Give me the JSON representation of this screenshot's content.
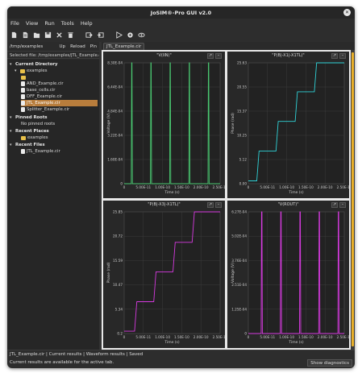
{
  "window": {
    "title": "JoSIM®-Pro GUI v2.0"
  },
  "menu": [
    "File",
    "View",
    "Run",
    "Tools",
    "Help"
  ],
  "toolbar": [
    {
      "icon": "new-file-icon"
    },
    {
      "icon": "open-file-icon"
    },
    {
      "icon": "open-folder-icon"
    },
    {
      "icon": "save-icon"
    },
    {
      "icon": "cut-icon"
    },
    {
      "icon": "delete-icon"
    },
    {
      "icon": "import-icon"
    },
    {
      "icon": "export-icon"
    },
    {
      "icon": "run-icon"
    },
    {
      "icon": "settings-icon"
    },
    {
      "icon": "view-icon"
    }
  ],
  "left": {
    "path": "/tmp/examples",
    "btn_up": "Up",
    "btn_reload": "Reload",
    "btn_pin": "Pin",
    "selected_file": "Selected file: /tmp/examples/JTL_Example.cir",
    "current_directory_label": "Current Directory",
    "root_folder": "examples",
    "blank_folder": "",
    "files": [
      "AND_Example.cir",
      "base_cells.cir",
      "DFF_Example.cir",
      "JTL_Example.cir",
      "Splitter_Example.cir"
    ],
    "pinned_roots_label": "Pinned Roots",
    "pinned_empty": "No pinned roots",
    "recent_places_label": "Recent Places",
    "recent_place": "examples",
    "recent_files_label": "Recent Files",
    "recent_file": "JTL_Example.cir"
  },
  "main": {
    "tab": "JTL_Example.cir",
    "maximize_label": "↗",
    "minimize_label": "–"
  },
  "status": {
    "line1": "JTL_Example.cir | Current results | Waveform results | Saved",
    "line2": "Current results are available for the active tab.",
    "diagnostics_button": "Show diagnostics"
  },
  "chart_data": [
    {
      "type": "line",
      "title": "\"V(IIN)\"",
      "xlabel": "Time (s)",
      "ylabel": "Voltage (V)",
      "color": "#49c770",
      "xlim": [
        0,
        2.5e-10
      ],
      "ylim": [
        0,
        0.000806
      ],
      "x_ticks": [
        "0",
        "5.00E-11",
        "1.00E-10",
        "1.50E-10",
        "2.00E-10",
        "2.50E-10"
      ],
      "y_ticks": [
        "0",
        "1.60E-04",
        "3.22E-04",
        "4.84E-04",
        "6.44E-04",
        "8.30E-04"
      ],
      "pulses_at": [
        2e-11,
        7e-11,
        1.2e-10,
        1.7e-10,
        2.2e-10
      ],
      "peak": 0.000806
    },
    {
      "type": "line",
      "title": "\"P(B|-X1|-X1TL)\"",
      "xlabel": "Time (s)",
      "ylabel": "Phase (rad)",
      "color": "#2fd3d8",
      "xlim": [
        0,
        2.5e-10
      ],
      "ylim": [
        0,
        25.63
      ],
      "x_ticks": [
        "0",
        "5.00E-11",
        "1.00E-10",
        "1.50E-10",
        "2.00E-10",
        "2.50E-10"
      ],
      "y_ticks": [
        "0.00",
        "5.12",
        "10.25",
        "15.37",
        "20.55",
        "25.63"
      ],
      "steps": [
        [
          0,
          0.6
        ],
        [
          2.5e-11,
          6.9
        ],
        [
          7.5e-11,
          13.2
        ],
        [
          1.25e-10,
          19.5
        ],
        [
          1.75e-10,
          25.63
        ]
      ]
    },
    {
      "type": "line",
      "title": "\"P(B|-X3|-X1TL)\"",
      "xlabel": "Time (s)",
      "ylabel": "Phase (rad)",
      "color": "#d63adf",
      "xlim": [
        0,
        2.5e-10
      ],
      "ylim": [
        0.2,
        25.81
      ],
      "x_ticks": [
        "0",
        "5.00E-11",
        "1.00E-10",
        "1.50E-10",
        "2.00E-10",
        "2.50E-10"
      ],
      "y_ticks": [
        "0.2",
        "5.34",
        "10.47",
        "15.59",
        "20.72",
        "25.85"
      ],
      "steps": [
        [
          0,
          0.7
        ],
        [
          3e-11,
          6.9
        ],
        [
          8e-11,
          13.2
        ],
        [
          1.3e-10,
          19.4
        ],
        [
          1.8e-10,
          25.81
        ]
      ]
    },
    {
      "type": "line",
      "title": "\"V(ROUT)\"",
      "xlabel": "Time (s)",
      "ylabel": "Voltage (V)",
      "color": "#d63adf",
      "xlim": [
        0,
        2.5e-10
      ],
      "ylim": [
        0,
        0.000627
      ],
      "x_ticks": [
        "0",
        "5.00E-11",
        "1.00E-10",
        "1.50E-10",
        "2.00E-10",
        "2.50E-10"
      ],
      "y_ticks": [
        "0",
        "1.25E-04",
        "2.51E-04",
        "3.76E-04",
        "5.02E-04",
        "6.27E-04"
      ],
      "pulses_at": [
        3.5e-11,
        8.5e-11,
        1.35e-10,
        1.85e-10,
        2.35e-10
      ],
      "peak": 0.000627
    }
  ]
}
